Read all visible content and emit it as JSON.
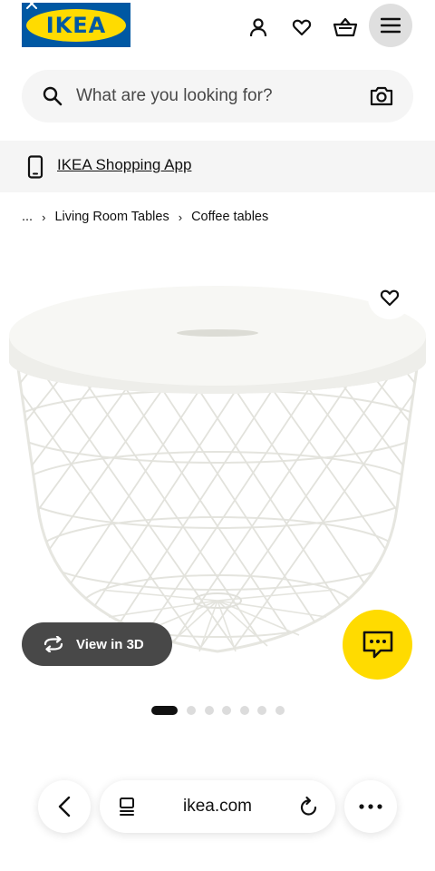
{
  "header": {
    "brand": "IKEA",
    "icons": [
      "user-icon",
      "heart-icon",
      "basket-icon",
      "hamburger-menu-icon"
    ]
  },
  "search": {
    "placeholder": "What are you looking for?",
    "icons": [
      "search-icon",
      "camera-icon"
    ]
  },
  "banner": {
    "link_label": "IKEA Shopping App",
    "icon": "smartphone-icon"
  },
  "breadcrumb": {
    "ellipsis": "...",
    "items": [
      "Living Room Tables",
      "Coffee tables"
    ]
  },
  "product": {
    "view_3d_label": "View in 3D",
    "image_count": 7,
    "active_image_index": 0
  },
  "browser": {
    "url": "ikea.com",
    "icons": [
      "back-icon",
      "tabs-icon",
      "reload-icon",
      "more-icon"
    ]
  },
  "colors": {
    "ikea_blue": "#0058a3",
    "ikea_yellow": "#ffdb00",
    "dark_pill": "#484848",
    "light_gray": "#f5f5f5"
  }
}
